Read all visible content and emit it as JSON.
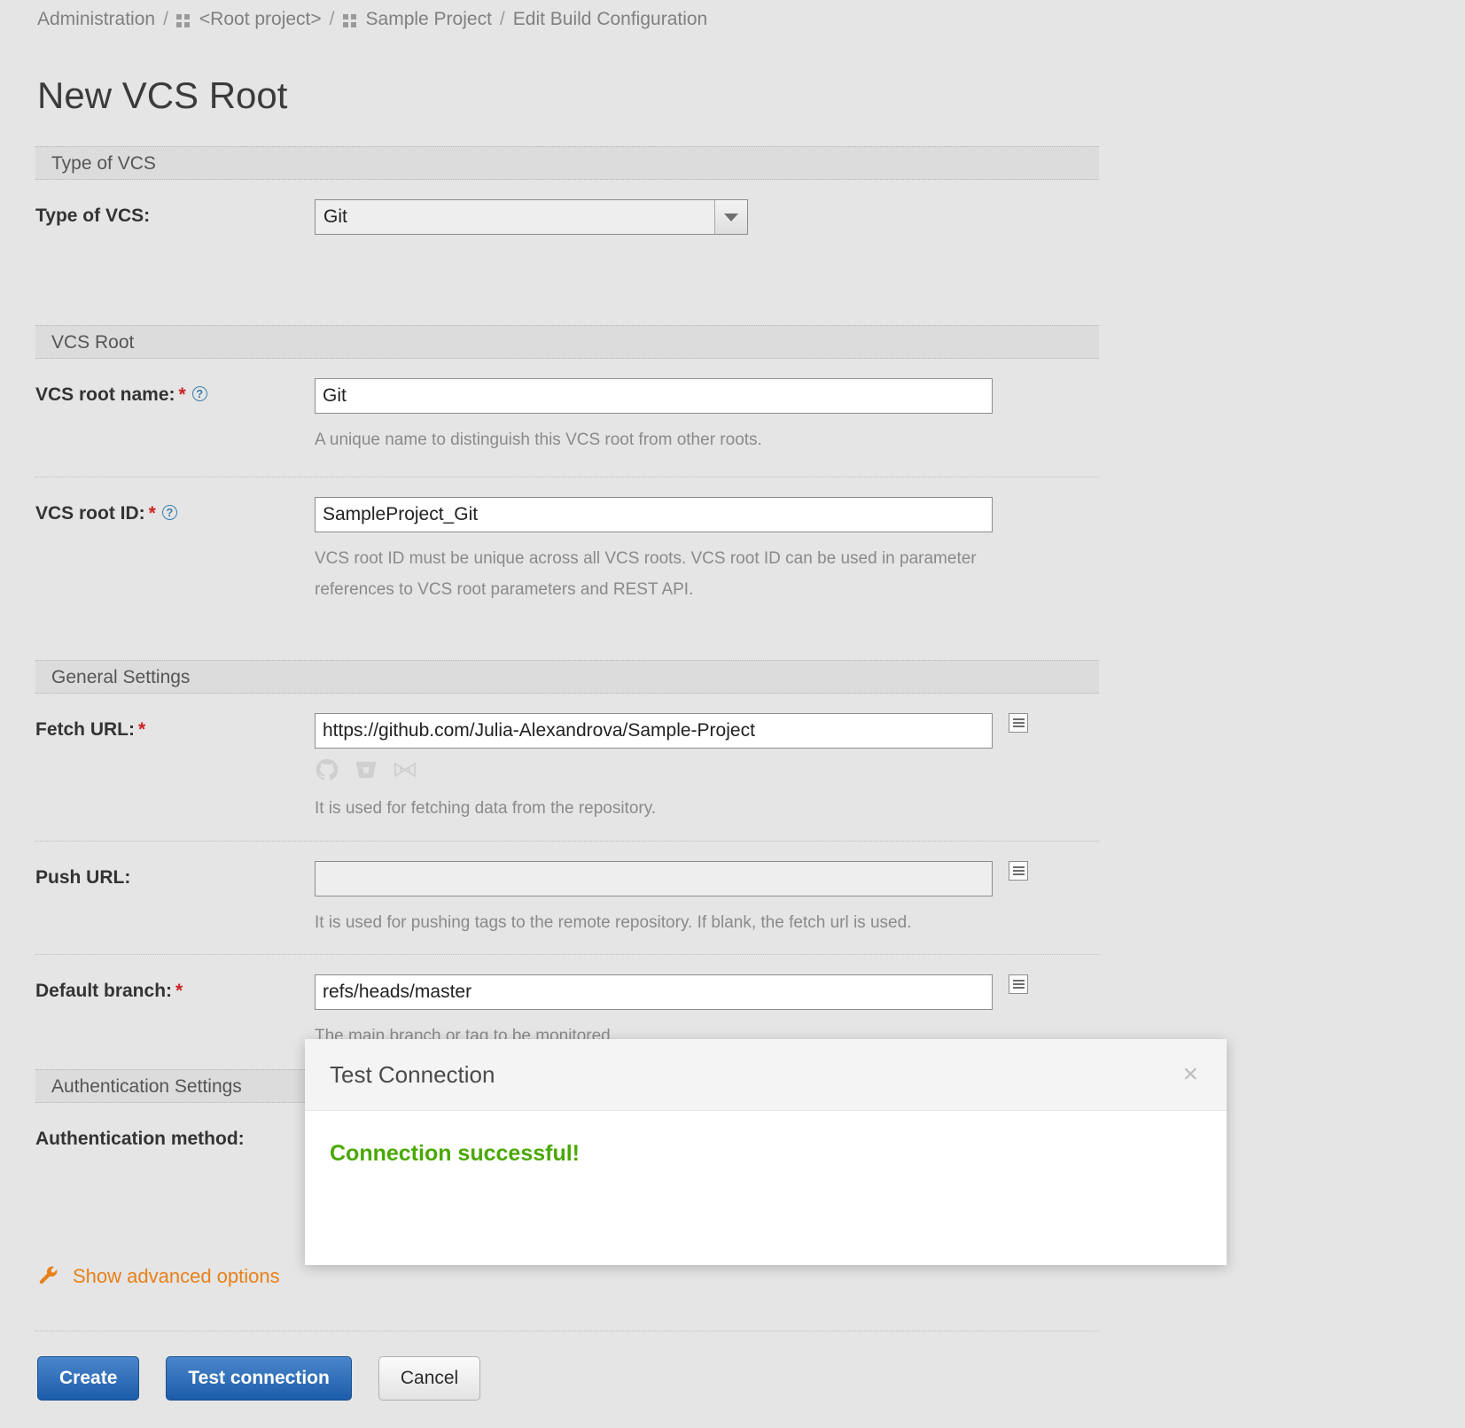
{
  "breadcrumb": {
    "items": [
      {
        "label": "Administration",
        "icon": null
      },
      {
        "label": "<Root project>",
        "icon": "project-grid-icon"
      },
      {
        "label": "Sample Project",
        "icon": "project-grid-icon"
      },
      {
        "label": "Edit Build Configuration",
        "icon": null
      }
    ],
    "separator": "/"
  },
  "page": {
    "title": "New VCS Root"
  },
  "sections": {
    "type_of_vcs": {
      "header": "Type of VCS",
      "field": {
        "label": "Type of VCS:",
        "value": "Git",
        "options": [
          "Git"
        ]
      }
    },
    "vcs_root": {
      "header": "VCS Root",
      "name": {
        "label": "VCS root name:",
        "required": "*",
        "help": "?",
        "value": "Git",
        "hint": "A unique name to distinguish this VCS root from other roots."
      },
      "id": {
        "label": "VCS root ID:",
        "required": "*",
        "help": "?",
        "value": "SampleProject_Git",
        "hint": "VCS root ID must be unique across all VCS roots. VCS root ID can be used in parameter references to VCS root parameters and REST API."
      }
    },
    "general_settings": {
      "header": "General Settings",
      "fetch_url": {
        "label": "Fetch URL:",
        "required": "*",
        "value": "https://github.com/Julia-Alexandrova/Sample-Project",
        "placeholder": "",
        "hint": "It is used for fetching data from the repository.",
        "providers": [
          "github-icon",
          "bitbucket-icon",
          "vsts-icon"
        ]
      },
      "push_url": {
        "label": "Push URL:",
        "required": "",
        "value": "",
        "placeholder": "",
        "hint": "It is used for pushing tags to the remote repository. If blank, the fetch url is used."
      },
      "default_branch": {
        "label": "Default branch:",
        "required": "*",
        "value": "refs/heads/master",
        "placeholder": "",
        "hint": "The main branch or tag to be monitored"
      }
    },
    "authentication_settings": {
      "header": "Authentication Settings",
      "method": {
        "label": "Authentication method:"
      }
    }
  },
  "advanced_link": {
    "icon": "wrench-icon",
    "label": "Show advanced options"
  },
  "actions": {
    "create": "Create",
    "test_connection": "Test connection",
    "cancel": "Cancel"
  },
  "dialog": {
    "title": "Test Connection",
    "close": "×",
    "message": "Connection successful!"
  },
  "colors": {
    "accent_orange": "#e8801a",
    "primary_blue": "#1c5ca8",
    "success_green": "#4aa802",
    "required_red": "#cc2222",
    "help_blue": "#3c7fb1",
    "page_bg": "#e5e5e5"
  }
}
